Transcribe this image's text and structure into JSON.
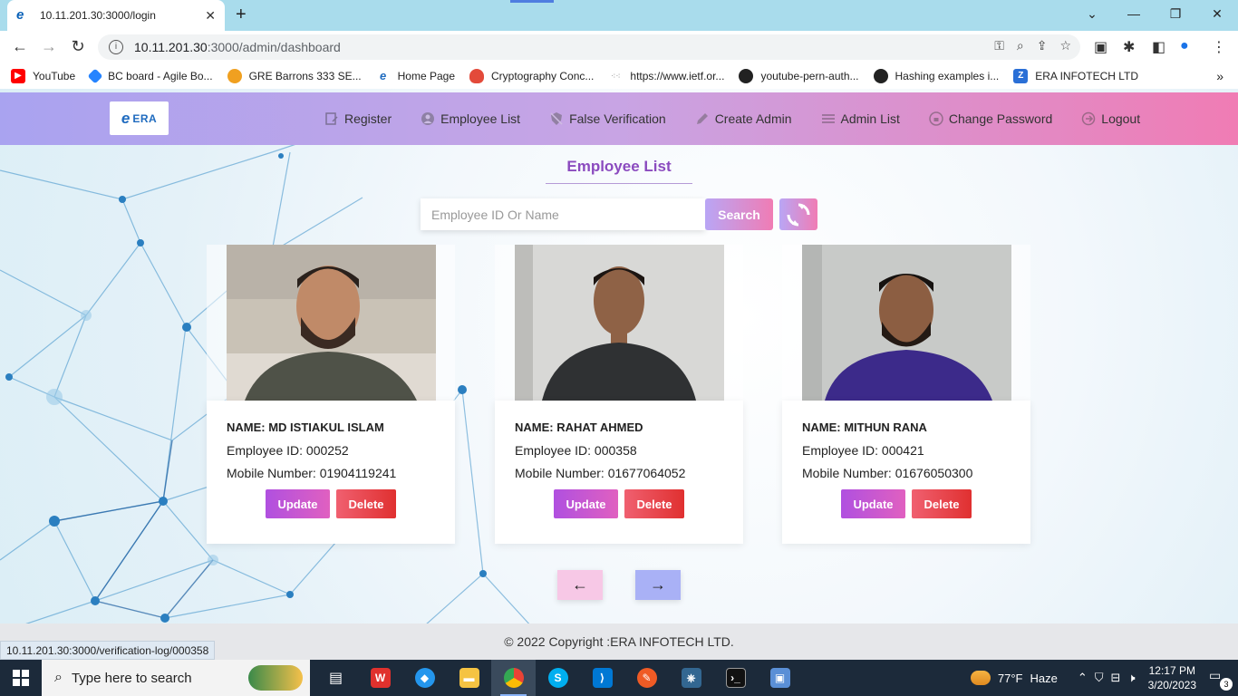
{
  "browser": {
    "tab_title": "10.11.201.30:3000/login",
    "tab_close": "✕",
    "new_tab": "+",
    "url_host": "10.11.201.30",
    "url_path": ":3000/admin/dashboard",
    "window_controls": [
      "⌄",
      "—",
      "❐",
      "✕"
    ]
  },
  "bookmarks": [
    {
      "label": "YouTube",
      "icon": "youtube-icon",
      "color": "#ff0000"
    },
    {
      "label": "BC board - Agile Bo...",
      "icon": "jira-icon",
      "color": "#2684ff"
    },
    {
      "label": "GRE Barrons 333 SE...",
      "icon": "bulb-icon",
      "color": "#f0a020"
    },
    {
      "label": "Home Page",
      "icon": "ie-icon",
      "color": "#1f6bbf"
    },
    {
      "label": "Cryptography Conc...",
      "icon": "flame-icon",
      "color": "#e34a3a"
    },
    {
      "label": "https://www.ietf.or...",
      "icon": "ietf-icon",
      "color": "#888888"
    },
    {
      "label": "youtube-pern-auth...",
      "icon": "github-icon",
      "color": "#222222"
    },
    {
      "label": "Hashing examples i...",
      "icon": "github-icon",
      "color": "#222222"
    },
    {
      "label": "ERA INFOTECH LTD",
      "icon": "z-icon",
      "color": "#2a6fd6"
    }
  ],
  "navbar": {
    "logo_mark": "e",
    "logo_text": "ERA",
    "links": [
      {
        "label": "Register",
        "icon": "register-icon"
      },
      {
        "label": "Employee List",
        "icon": "user-icon"
      },
      {
        "label": "False Verification",
        "icon": "shield-icon"
      },
      {
        "label": "Create Admin",
        "icon": "pencil-icon"
      },
      {
        "label": "Admin List",
        "icon": "list-icon"
      },
      {
        "label": "Change Password",
        "icon": "lock-icon"
      },
      {
        "label": "Logout",
        "icon": "logout-icon"
      }
    ]
  },
  "page": {
    "title": "Employee List",
    "search_placeholder": "Employee ID Or Name",
    "search_button": "Search",
    "prev_label": "←",
    "next_label": "→"
  },
  "employees": [
    {
      "name": "NAME: MD ISTIAKUL ISLAM",
      "employee_id": "Employee ID: 000252",
      "mobile": "Mobile Number: 01904119241",
      "update": "Update",
      "delete": "Delete"
    },
    {
      "name": "NAME: RAHAT AHMED",
      "employee_id": "Employee ID: 000358",
      "mobile": "Mobile Number: 01677064052",
      "update": "Update",
      "delete": "Delete"
    },
    {
      "name": "NAME: MITHUN RANA",
      "employee_id": "Employee ID: 000421",
      "mobile": "Mobile Number: 01676050300",
      "update": "Update",
      "delete": "Delete"
    }
  ],
  "footer": {
    "copyright": "© 2022 Copyright :ERA INFOTECH LTD."
  },
  "status_link": "10.11.201.30:3000/verification-log/000358",
  "taskbar": {
    "search_placeholder": "Type here to search",
    "weather_temp": "77°F",
    "weather_desc": "Haze",
    "time": "12:17 PM",
    "date": "3/20/2023",
    "notification_count": "3"
  },
  "colors": {
    "navbar_gradient_start": "#a9a3f0",
    "navbar_gradient_end": "#f07cb4",
    "title_color": "#8b4bbf",
    "update_button": "#c050d8",
    "delete_button": "#e84040"
  }
}
